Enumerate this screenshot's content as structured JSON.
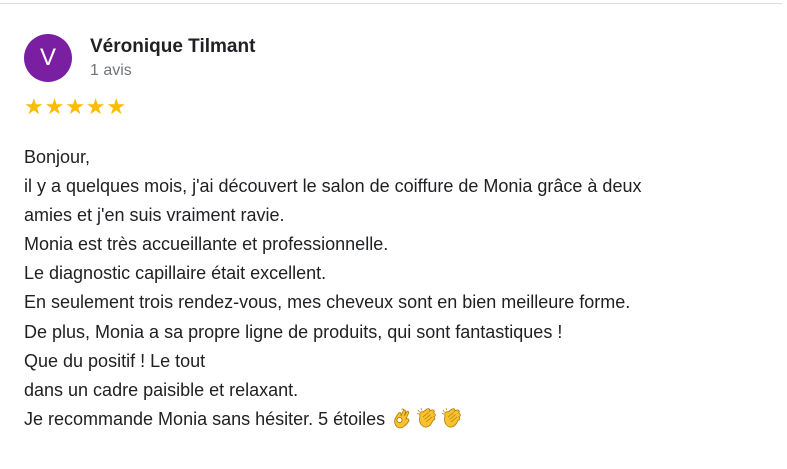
{
  "review": {
    "avatar_letter": "V",
    "author": "Véronique Tilmant",
    "review_count": "1 avis",
    "rating": 5,
    "rating_max": 5,
    "star_glyph": "★",
    "star_color": "#fbbc04",
    "avatar_color": "#7b1fa2",
    "lines": [
      "Bonjour,",
      "il y a quelques mois, j'ai découvert le salon de coiffure de Monia grâce à deux",
      "amies et j'en suis vraiment ravie.",
      "Monia est très accueillante et professionnelle.",
      "Le diagnostic capillaire était excellent.",
      "En seulement trois rendez-vous, mes cheveux sont en bien meilleure forme.",
      "De plus, Monia a sa propre ligne de produits, qui sont fantastiques !",
      "Que du positif ! Le tout",
      "dans un cadre paisible et relaxant.",
      "Je recommande Monia sans hésiter. 5 étoiles"
    ],
    "trailing_emojis": [
      "ok-hand-icon",
      "clapping-hands-icon",
      "clapping-hands-icon"
    ]
  }
}
